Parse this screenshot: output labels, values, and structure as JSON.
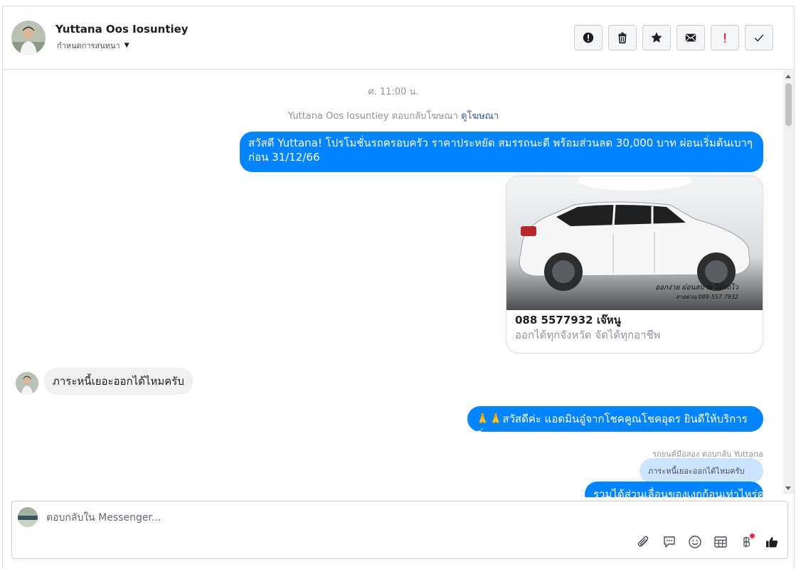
{
  "header": {
    "contact_name": "Yuttana Oos Iosuntiey",
    "subtitle": "กำหนดการสนทนา",
    "actions": [
      {
        "icon": "alert-circle-icon",
        "name": "report-button"
      },
      {
        "icon": "trash-icon",
        "name": "delete-button"
      },
      {
        "icon": "star-icon",
        "name": "star-button"
      },
      {
        "icon": "envelope-icon",
        "name": "mark-unread-button"
      },
      {
        "icon": "exclamation-icon",
        "name": "spam-button"
      },
      {
        "icon": "check-icon",
        "name": "mark-done-button"
      }
    ]
  },
  "thread": {
    "timestamp": "ศ. 11:00 น.",
    "ad_reply_note": "Yuttana Oos Iosuntiey ตอบกลับโฆษณา",
    "ad_reply_link": "ดูโฆษณา",
    "messages": {
      "promo_line1": "สวัสดี Yuttana! โปรโมชั่นรถครอบครัว ราคาประหยัด สมรรถนะดี พร้อมส่วนลด 30,000 บาท ผ่อนเริ่มต้นเบาๆ",
      "promo_line2": "ก่อน 31/12/66",
      "incoming_question": "ภาระหนี้เยอะออกได้ไหมครับ",
      "reply_greeting": "🙏🙏สวัสดีค่ะ แอดมินอู๋จากโชคคูณโชคอุดร ยินดีให้บริการค่ะ",
      "reply_meta": "รถยนต์มือสอง ตอบกลับ Yuttana",
      "quoted_text": "ภาระหนี้เยอะออกได้ไหมครับ",
      "partial_reply": "รวมได้ส่วนเลื่อนของเงกก้อนเท่าไหร่ค่ะ"
    },
    "ad_card": {
      "title": "088 5577932 เจ๊หนู",
      "description": "ออกได้ทุกจังหวัด จัดได้ทุกอาชีพ",
      "image_caption_line1": "ออกง่าย ผ่อนสบาย ได้รถไว",
      "image_caption_line2": "สายด่วน 088-557 7932"
    }
  },
  "composer": {
    "placeholder": "ตอบกลับใน Messenger...",
    "tools": [
      "paperclip-icon",
      "saved-reply-icon",
      "emoji-icon",
      "table-icon",
      "baht-icon",
      "thumbs-up-icon"
    ]
  },
  "colors": {
    "accent": "#0084ff",
    "incoming_bubble": "#f1f0f0",
    "quoted_bubble": "#cce4ff",
    "link": "#385898"
  }
}
